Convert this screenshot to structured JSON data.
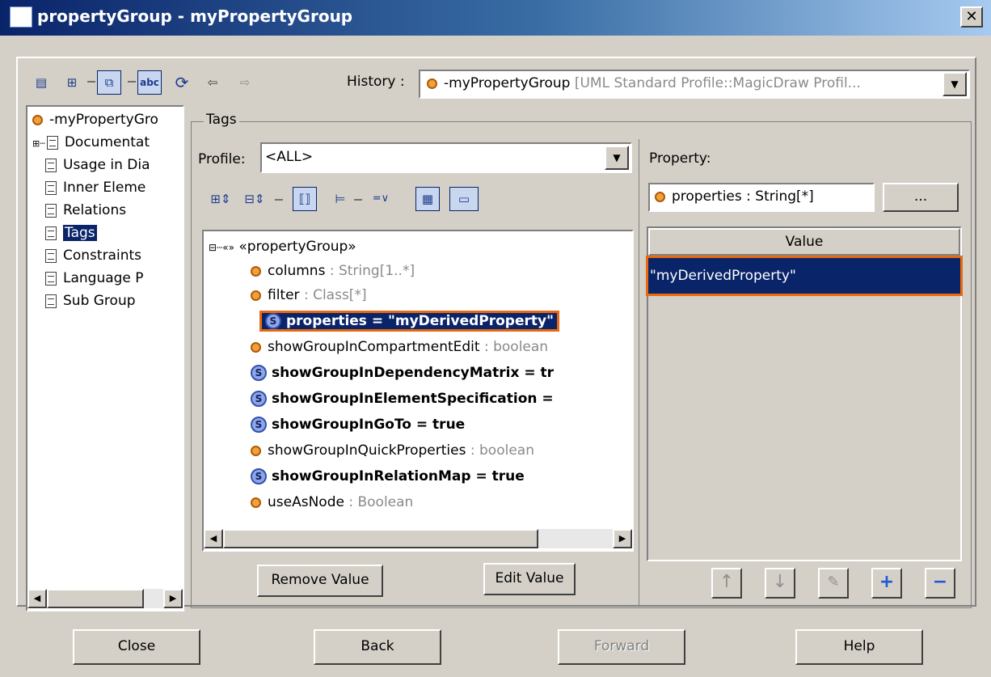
{
  "window": {
    "title": "propertyGroup - myPropertyGroup"
  },
  "toolbar": {
    "history_label": "History :",
    "history_element": "-myPropertyGroup",
    "history_path": "[UML Standard Profile::MagicDraw Profil...",
    "icons": [
      "details-icon",
      "tree-icon",
      "frame-icon",
      "abc-icon",
      "refresh-icon",
      "back-arrow-icon",
      "forward-arrow-icon"
    ]
  },
  "nav": {
    "items": [
      {
        "label": "-myPropertyGro"
      },
      {
        "label": "Documentat"
      },
      {
        "label": "Usage in Dia"
      },
      {
        "label": "Inner Eleme"
      },
      {
        "label": "Relations"
      },
      {
        "label": "Tags"
      },
      {
        "label": "Constraints"
      },
      {
        "label": "Language P"
      },
      {
        "label": "Sub Group"
      }
    ],
    "selected": "Tags"
  },
  "tags": {
    "group_title": "Tags",
    "profile_label": "Profile:",
    "profile_value": "<ALL>",
    "stereotype": "«propertyGroup»",
    "rows": [
      {
        "name": "columns",
        "type": " : String[1..*]",
        "kind": "empty"
      },
      {
        "name": "filter",
        "type": " : Class[*]",
        "kind": "empty"
      },
      {
        "name": "properties = \"myDerivedProperty\"",
        "type": "",
        "kind": "selected"
      },
      {
        "name": "showGroupInCompartmentEdit",
        "type": " : boolean",
        "kind": "empty"
      },
      {
        "name": "showGroupInDependencyMatrix = tr",
        "type": "",
        "kind": "set"
      },
      {
        "name": "showGroupInElementSpecification =",
        "type": "",
        "kind": "set"
      },
      {
        "name": "showGroupInGoTo = true",
        "type": "",
        "kind": "set"
      },
      {
        "name": "showGroupInQuickProperties",
        "type": " : boolean",
        "kind": "empty"
      },
      {
        "name": "showGroupInRelationMap = true",
        "type": "",
        "kind": "set"
      },
      {
        "name": "useAsNode",
        "type": " : Boolean",
        "kind": "empty"
      }
    ],
    "remove_value": "Remove Value",
    "edit_value": "Edit Value"
  },
  "property": {
    "label": "Property:",
    "value": "properties : String[*]",
    "ellipsis": "...",
    "column_header": "Value",
    "values": [
      "\"myDerivedProperty\""
    ]
  },
  "footer": {
    "close": "Close",
    "back": "Back",
    "forward": "Forward",
    "help": "Help"
  },
  "colors": {
    "selection": "#0a246a",
    "highlight_outline": "#e86a10",
    "panel": "#d4d0c8"
  }
}
